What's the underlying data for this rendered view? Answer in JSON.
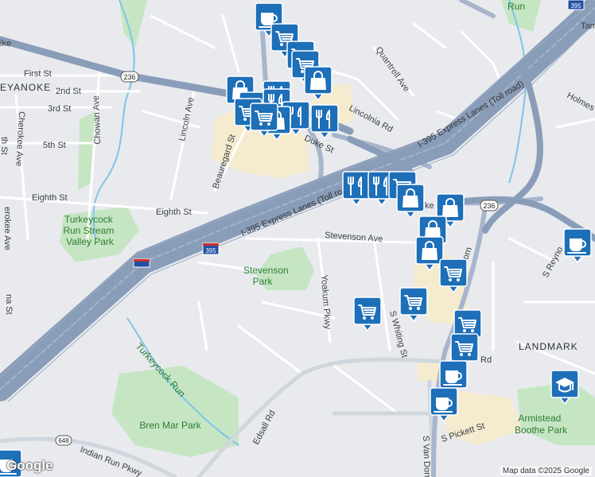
{
  "map": {
    "place_labels": [
      {
        "id": "first-st",
        "text": "First St"
      },
      {
        "id": "keyanoke",
        "text": "EYANOKE"
      },
      {
        "id": "second-st",
        "text": "2nd St"
      },
      {
        "id": "third-st",
        "text": "3rd St"
      },
      {
        "id": "fifth-st",
        "text": "5th St"
      },
      {
        "id": "eighth-st-left",
        "text": "Eighth St"
      },
      {
        "id": "eighth-st",
        "text": "Eighth St"
      },
      {
        "id": "chowan-ave",
        "text": "Chowan Ave"
      },
      {
        "id": "cherokee-ave",
        "text": "Cherokee Ave"
      },
      {
        "id": "lincoln-ave",
        "text": "Lincoln Ave"
      },
      {
        "id": "beauregard-st",
        "text": "Beauregard St"
      },
      {
        "id": "duke-st",
        "text": "Duke St"
      },
      {
        "id": "lincolnia-rd",
        "text": "Lincolnia Rd"
      },
      {
        "id": "quantrell-ave",
        "text": "Quantrell Ave"
      },
      {
        "id": "holmes-run",
        "text": "Holmes R"
      },
      {
        "id": "stevenson-ave",
        "text": "Stevenson Ave"
      },
      {
        "id": "yeakum-pkwy",
        "text": "Yoakum Pkwy"
      },
      {
        "id": "s-whiting-st",
        "text": "S Whiting St"
      },
      {
        "id": "s-van-dorn-upper",
        "text": "S Van Dorn"
      },
      {
        "id": "s-reynolds",
        "text": "S Reyno"
      },
      {
        "id": "landmark",
        "text": "LANDMARK"
      },
      {
        "id": "edsall-rd",
        "text": "Edsall Rd"
      },
      {
        "id": "indian-run",
        "text": "Indian Run Pkwy"
      },
      {
        "id": "s-pickett-st",
        "text": "S Pickett St"
      },
      {
        "id": "s-van-dorn-lower",
        "text": "S Van Dorn"
      },
      {
        "id": "turkeycock-run",
        "text": "Turkeycock Run"
      },
      {
        "id": "tam",
        "text": "Tam"
      },
      {
        "id": "ike",
        "text": "ike"
      },
      {
        "id": "rd",
        "text": "Rd"
      },
      {
        "id": "ke",
        "text": "ke"
      },
      {
        "id": "na-st",
        "text": "na St"
      },
      {
        "id": "th-st",
        "text": "th St"
      },
      {
        "id": "erokee-ave",
        "text": "erokee Ave"
      },
      {
        "id": "run",
        "text": "Run"
      }
    ],
    "parks": [
      {
        "id": "turkeycock-park",
        "text": [
          "Turkeycock",
          "Run Stream",
          "Valley Park"
        ]
      },
      {
        "id": "stevenson-park",
        "text": [
          "Stevenson",
          "Park"
        ]
      },
      {
        "id": "bren-mar-park",
        "text": [
          "Bren Mar Park"
        ]
      },
      {
        "id": "armistead-park",
        "text": [
          "Armistead",
          "Boothe Park"
        ]
      }
    ],
    "highways": [
      {
        "id": "i395-express-upper",
        "text": "I-395 Express Lanes (Toll road)"
      },
      {
        "id": "i395-express-lower",
        "text": "I-395 Express Lanes (Toll road)"
      }
    ],
    "route_shields": [
      {
        "id": "shield-236-left",
        "text": "236"
      },
      {
        "id": "shield-236-right",
        "text": "236"
      },
      {
        "id": "shield-395",
        "text": "395"
      },
      {
        "id": "shield-395-top",
        "text": "395"
      },
      {
        "id": "shield-648",
        "text": "648"
      }
    ],
    "markers": [
      {
        "icon": "coffee-icon"
      },
      {
        "icon": "shopping-cart-icon"
      },
      {
        "icon": "shopping-cart-icon"
      },
      {
        "icon": "shopping-cart-icon"
      },
      {
        "icon": "shopping-bag-icon"
      },
      {
        "icon": "shopping-bag-icon"
      },
      {
        "icon": "shopping-cart-icon"
      },
      {
        "icon": "shopping-cart-icon"
      },
      {
        "icon": "restaurant-icon"
      },
      {
        "icon": "restaurant-icon"
      },
      {
        "icon": "restaurant-icon"
      },
      {
        "icon": "shopping-bag-icon"
      },
      {
        "icon": "shopping-cart-icon"
      },
      {
        "icon": "restaurant-icon"
      },
      {
        "icon": "restaurant-icon"
      },
      {
        "icon": "restaurant-icon"
      },
      {
        "icon": "shopping-cart-icon"
      },
      {
        "icon": "shopping-bag-icon"
      },
      {
        "icon": "shopping-bag-icon"
      },
      {
        "icon": "shopping-bag-icon"
      },
      {
        "icon": "shopping-bag-icon"
      },
      {
        "icon": "shopping-cart-icon"
      },
      {
        "icon": "shopping-cart-icon"
      },
      {
        "icon": "shopping-cart-icon"
      },
      {
        "icon": "shopping-cart-icon"
      },
      {
        "icon": "shopping-cart-icon"
      },
      {
        "icon": "coffee-icon"
      },
      {
        "icon": "coffee-icon"
      },
      {
        "icon": "coffee-icon"
      },
      {
        "icon": "school-icon"
      },
      {
        "icon": "coffee-icon"
      }
    ]
  },
  "branding": {
    "logo_text": "Google",
    "attribution": "Map data ©2025 Google"
  },
  "colors": {
    "marker": "#1d6fb8",
    "highway": "#8a9db8",
    "park": "#c6e6c3",
    "commercial": "#f5ebcf",
    "water": "#7fc4e8",
    "background": "#e8eaee"
  }
}
